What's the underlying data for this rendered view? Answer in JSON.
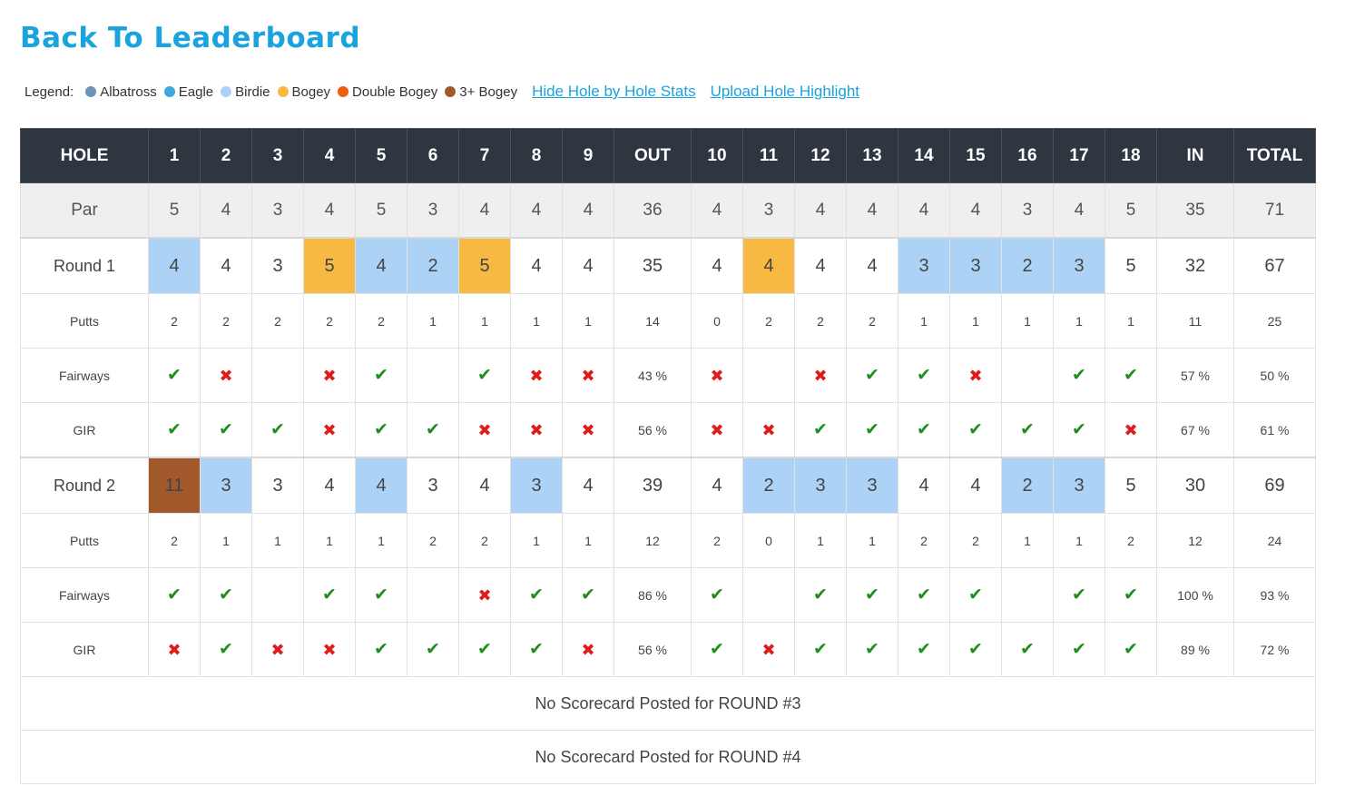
{
  "back_link": "Back To Leaderboard",
  "legend": {
    "label": "Legend:",
    "items": [
      {
        "name": "Albatross",
        "color": "#6a93b8"
      },
      {
        "name": "Eagle",
        "color": "#3aa9de"
      },
      {
        "name": "Birdie",
        "color": "#acd3f6"
      },
      {
        "name": "Bogey",
        "color": "#f7b941"
      },
      {
        "name": "Double Bogey",
        "color": "#ec5e0c"
      },
      {
        "name": "3+ Bogey",
        "color": "#a1582a"
      }
    ],
    "hide_stats_link": "Hide Hole by Hole Stats",
    "upload_link": "Upload Hole Highlight"
  },
  "header": [
    "HOLE",
    "1",
    "2",
    "3",
    "4",
    "5",
    "6",
    "7",
    "8",
    "9",
    "OUT",
    "10",
    "11",
    "12",
    "13",
    "14",
    "15",
    "16",
    "17",
    "18",
    "IN",
    "TOTAL"
  ],
  "par": {
    "label": "Par",
    "cells": [
      "5",
      "4",
      "3",
      "4",
      "5",
      "3",
      "4",
      "4",
      "4",
      "36",
      "4",
      "3",
      "4",
      "4",
      "4",
      "4",
      "3",
      "4",
      "5",
      "35",
      "71"
    ]
  },
  "rounds": [
    {
      "label": "Round 1",
      "scores": [
        "4",
        "4",
        "3",
        "5",
        "4",
        "2",
        "5",
        "4",
        "4",
        "35",
        "4",
        "4",
        "4",
        "4",
        "3",
        "3",
        "2",
        "3",
        "5",
        "32",
        "67"
      ],
      "score_types": [
        "birdie",
        "",
        "",
        "bogey",
        "birdie",
        "birdie",
        "bogey",
        "",
        "",
        "",
        "",
        "bogey",
        "",
        "",
        "birdie",
        "birdie",
        "birdie",
        "birdie",
        "",
        "",
        ""
      ],
      "stats": [
        {
          "label": "Putts",
          "cells": [
            "2",
            "2",
            "2",
            "2",
            "2",
            "1",
            "1",
            "1",
            "1",
            "14",
            "0",
            "2",
            "2",
            "2",
            "1",
            "1",
            "1",
            "1",
            "1",
            "11",
            "25"
          ]
        },
        {
          "label": "Fairways",
          "cells": [
            "yes",
            "no",
            "",
            "no",
            "yes",
            "",
            "yes",
            "no",
            "no",
            "43 %",
            "no",
            "",
            "no",
            "yes",
            "yes",
            "no",
            "",
            "yes",
            "yes",
            "57 %",
            "50 %"
          ]
        },
        {
          "label": "GIR",
          "cells": [
            "yes",
            "yes",
            "yes",
            "no",
            "yes",
            "yes",
            "no",
            "no",
            "no",
            "56 %",
            "no",
            "no",
            "yes",
            "yes",
            "yes",
            "yes",
            "yes",
            "yes",
            "no",
            "67 %",
            "61 %"
          ]
        }
      ]
    },
    {
      "label": "Round 2",
      "scores": [
        "11",
        "3",
        "3",
        "4",
        "4",
        "3",
        "4",
        "3",
        "4",
        "39",
        "4",
        "2",
        "3",
        "3",
        "4",
        "4",
        "2",
        "3",
        "5",
        "30",
        "69"
      ],
      "score_types": [
        "triple",
        "birdie",
        "",
        "",
        "birdie",
        "",
        "",
        "birdie",
        "",
        "",
        "",
        "birdie",
        "birdie",
        "birdie",
        "",
        "",
        "birdie",
        "birdie",
        "",
        "",
        ""
      ],
      "stats": [
        {
          "label": "Putts",
          "cells": [
            "2",
            "1",
            "1",
            "1",
            "1",
            "2",
            "2",
            "1",
            "1",
            "12",
            "2",
            "0",
            "1",
            "1",
            "2",
            "2",
            "1",
            "1",
            "2",
            "12",
            "24"
          ]
        },
        {
          "label": "Fairways",
          "cells": [
            "yes",
            "yes",
            "",
            "yes",
            "yes",
            "",
            "no",
            "yes",
            "yes",
            "86 %",
            "yes",
            "",
            "yes",
            "yes",
            "yes",
            "yes",
            "",
            "yes",
            "yes",
            "100 %",
            "93 %"
          ]
        },
        {
          "label": "GIR",
          "cells": [
            "no",
            "yes",
            "no",
            "no",
            "yes",
            "yes",
            "yes",
            "yes",
            "no",
            "56 %",
            "yes",
            "no",
            "yes",
            "yes",
            "yes",
            "yes",
            "yes",
            "yes",
            "yes",
            "89 %",
            "72 %"
          ]
        }
      ]
    }
  ],
  "no_scorecard_messages": [
    "No Scorecard Posted for ROUND #3",
    "No Scorecard Posted for ROUND #4"
  ],
  "icons": {
    "yes": "check-icon",
    "no": "cross-icon"
  }
}
